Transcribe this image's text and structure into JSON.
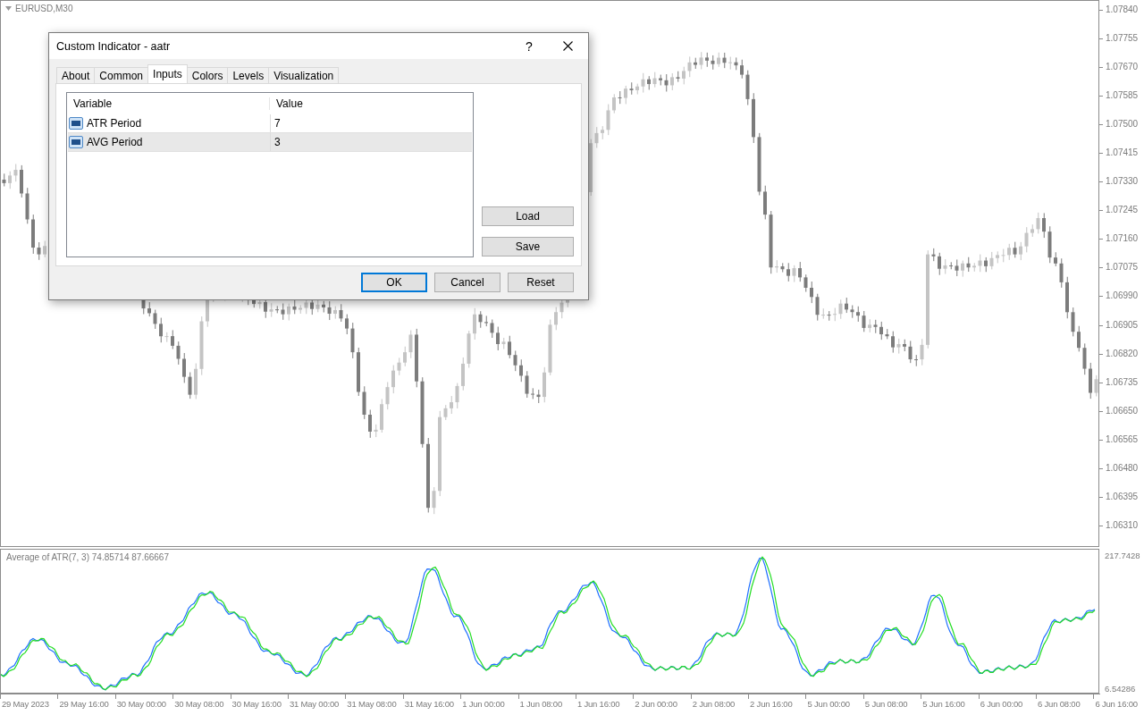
{
  "chart": {
    "symbol": "EURUSD,M30",
    "price_ticks": [
      "1.07840",
      "1.07755",
      "1.07670",
      "1.07585",
      "1.07500",
      "1.07415",
      "1.07330",
      "1.07245",
      "1.07160",
      "1.07075",
      "1.06990",
      "1.06905",
      "1.06820",
      "1.06735",
      "1.06650",
      "1.06565",
      "1.06480",
      "1.06395",
      "1.06310"
    ],
    "indicator": {
      "label": "Average of ATR(7, 3) 74.85714 87.66667",
      "axis_max": "217.7428",
      "axis_min": "6.54286"
    },
    "time_ticks": [
      "29 May 2023",
      "29 May 16:00",
      "30 May 00:00",
      "30 May 08:00",
      "30 May 16:00",
      "31 May 00:00",
      "31 May 08:00",
      "31 May 16:00",
      "1 Jun 00:00",
      "1 Jun 08:00",
      "1 Jun 16:00",
      "2 Jun 00:00",
      "2 Jun 08:00",
      "2 Jun 16:00",
      "5 Jun 00:00",
      "5 Jun 08:00",
      "5 Jun 16:00",
      "6 Jun 00:00",
      "6 Jun 08:00",
      "6 Jun 16:00"
    ]
  },
  "dialog": {
    "title": "Custom Indicator - aatr",
    "help": "?",
    "tabs": [
      {
        "label": "About",
        "selected": false
      },
      {
        "label": "Common",
        "selected": false
      },
      {
        "label": "Inputs",
        "selected": true
      },
      {
        "label": "Colors",
        "selected": false
      },
      {
        "label": "Levels",
        "selected": false
      },
      {
        "label": "Visualization",
        "selected": false
      }
    ],
    "table": {
      "columns": [
        "Variable",
        "Value"
      ],
      "rows": [
        {
          "variable": "ATR Period",
          "value": "7",
          "selected": false
        },
        {
          "variable": "AVG Period",
          "value": "3",
          "selected": true
        }
      ]
    },
    "side_buttons": [
      "Load",
      "Save"
    ],
    "buttons": [
      {
        "label": "OK",
        "default": true
      },
      {
        "label": "Cancel",
        "default": false
      },
      {
        "label": "Reset",
        "default": false
      }
    ]
  }
}
